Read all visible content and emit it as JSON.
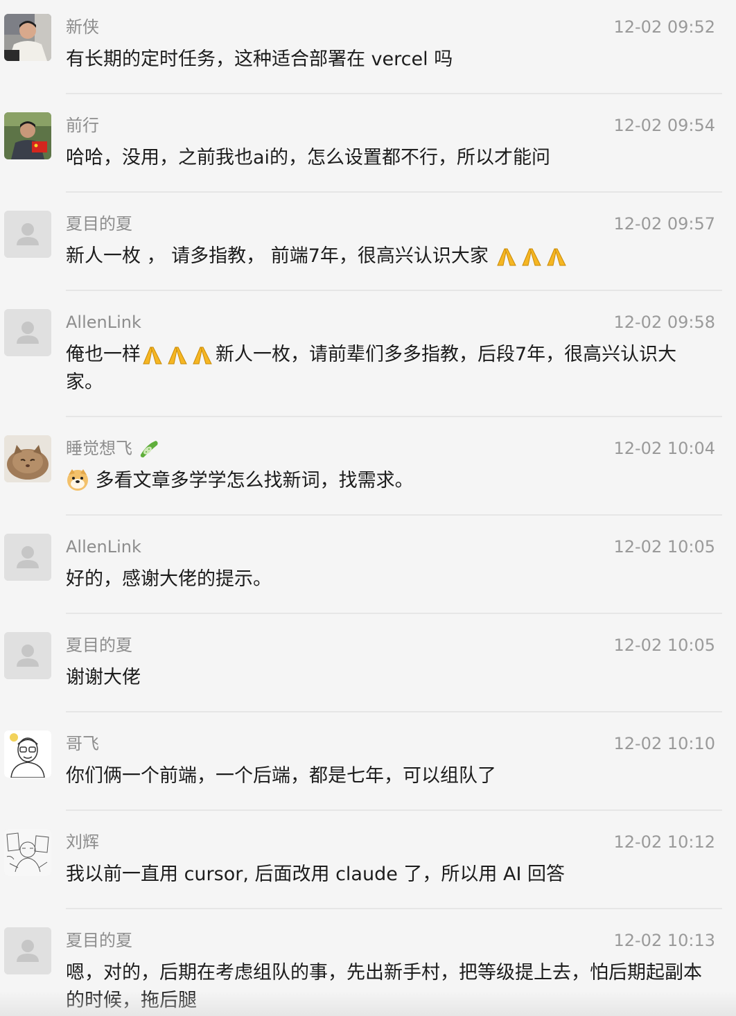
{
  "messages": [
    {
      "name": "新侠",
      "time": "12-02 09:52",
      "text": "有长期的定时任务，这种适合部署在 vercel 吗",
      "avatar": "photo-man-white-shirt"
    },
    {
      "name": "前行",
      "time": "12-02 09:54",
      "text": "哈哈，没用，之前我也ai的，怎么设置都不行，所以才能问",
      "avatar": "photo-man-red-flag"
    },
    {
      "name": "夏目的夏",
      "time": "12-02 09:57",
      "text_before": "新人一枚 ， 请多指教， 前端7年，很高兴认识大家 ",
      "emoji_after": "pray-emoji",
      "avatar": "default-avatar"
    },
    {
      "name": "AllenLink",
      "time": "12-02 09:58",
      "text_before": "俺也一样",
      "emoji_mid": "pray-emoji",
      "text_after": "新人一枚，请前辈们多多指教，后段7年，很高兴认识大家。",
      "avatar": "default-avatar"
    },
    {
      "name": "睡觉想飞",
      "name_emoji": "cucumber-emoji",
      "time": "12-02 10:04",
      "emoji_before": "doge-emoji",
      "text_after": " 多看文章多学学怎么找新词，找需求。",
      "avatar": "photo-cat"
    },
    {
      "name": "AllenLink",
      "time": "12-02 10:05",
      "text": "好的，感谢大佬的提示。",
      "avatar": "default-avatar"
    },
    {
      "name": "夏目的夏",
      "time": "12-02 10:05",
      "text": "谢谢大佬",
      "avatar": "default-avatar"
    },
    {
      "name": "哥飞",
      "time": "12-02 10:10",
      "text": "你们俩一个前端，一个后端，都是七年，可以组队了",
      "avatar": "cartoon-glasses-man"
    },
    {
      "name": "刘辉",
      "time": "12-02 10:12",
      "text": "我以前一直用 cursor, 后面改用 claude 了，所以用 AI 回答",
      "avatar": "sketch-drawing"
    },
    {
      "name": "夏目的夏",
      "time": "12-02 10:13",
      "text": "嗯，对的，后期在考虑组队的事，先出新手村，把等级提上去，怕后期起副本的时候，拖后腿",
      "avatar": "default-avatar"
    }
  ]
}
